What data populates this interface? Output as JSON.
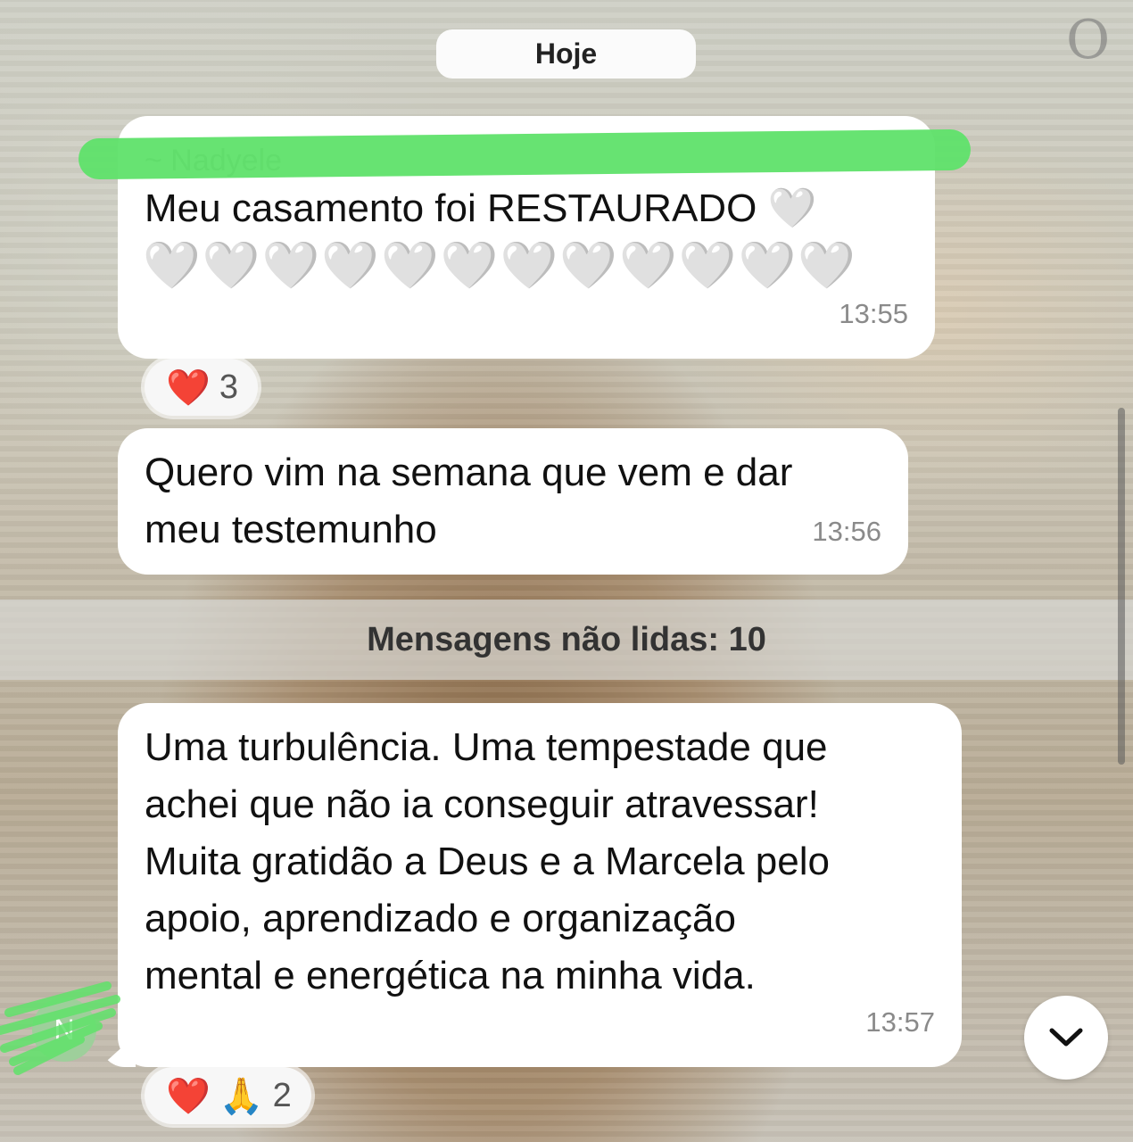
{
  "date_separator": "Hoje",
  "corner_glyph": "O",
  "messages": [
    {
      "sender": "~ Nadyele",
      "text": "Meu casamento foi RESTAURADO 🤍",
      "hearts": "🤍🤍🤍🤍🤍🤍🤍🤍🤍🤍🤍🤍",
      "time": "13:55",
      "reaction": {
        "emojis": "❤️",
        "count": "3"
      }
    },
    {
      "text": "Quero vim na semana que vem e dar\nmeu testemunho",
      "time": "13:56"
    },
    {
      "text": "Uma turbulência. Uma tempestade que\nachei que não ia conseguir atravessar!\nMuita gratidão a Deus e a Marcela pelo\napoio, aprendizado e organização\nmental e energética na minha vida.",
      "time": "13:57",
      "reaction": {
        "emoji_heart": "❤️",
        "emoji_pray": "🙏",
        "count": "2"
      }
    }
  ],
  "unread_label": "Mensagens não lidas: 10",
  "avatar_initial": "N",
  "colors": {
    "bubble": "#ffffff",
    "redaction": "#5fe26a",
    "time": "#8a8a8a"
  },
  "icons": {
    "scroll_down": "chevron-down-icon"
  }
}
